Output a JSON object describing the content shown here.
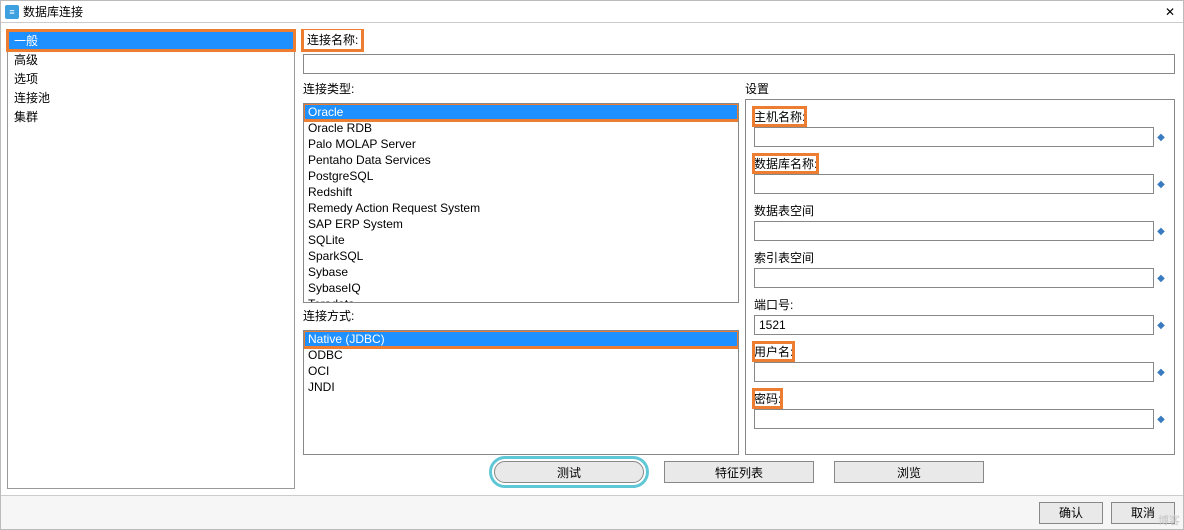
{
  "window": {
    "title": "数据库连接"
  },
  "sidebar": {
    "items": [
      {
        "label": "一般",
        "selected": true
      },
      {
        "label": "高级",
        "selected": false
      },
      {
        "label": "选项",
        "selected": false
      },
      {
        "label": "连接池",
        "selected": false
      },
      {
        "label": "集群",
        "selected": false
      }
    ]
  },
  "conn_name": {
    "label": "连接名称:",
    "value": ""
  },
  "conn_type": {
    "label": "连接类型:",
    "items": [
      {
        "label": "Oracle",
        "selected": true
      },
      {
        "label": "Oracle RDB"
      },
      {
        "label": "Palo MOLAP Server"
      },
      {
        "label": "Pentaho Data Services"
      },
      {
        "label": "PostgreSQL"
      },
      {
        "label": "Redshift"
      },
      {
        "label": "Remedy Action Request System"
      },
      {
        "label": "SAP ERP System"
      },
      {
        "label": "SQLite"
      },
      {
        "label": "SparkSQL"
      },
      {
        "label": "Sybase"
      },
      {
        "label": "SybaseIQ"
      },
      {
        "label": "Teradata"
      }
    ]
  },
  "conn_mode": {
    "label": "连接方式:",
    "items": [
      {
        "label": "Native (JDBC)",
        "selected": true
      },
      {
        "label": "ODBC"
      },
      {
        "label": "OCI"
      },
      {
        "label": "JNDI"
      }
    ]
  },
  "settings": {
    "title": "设置",
    "host_label": "主机名称:",
    "host": "",
    "db_label": "数据库名称:",
    "db": "",
    "ts_data_label": "数据表空间",
    "ts_data": "",
    "ts_index_label": "索引表空间",
    "ts_index": "",
    "port_label": "端口号:",
    "port": "1521",
    "user_label": "用户名:",
    "user": "",
    "pass_label": "密码:",
    "pass": ""
  },
  "buttons": {
    "test": "测试",
    "feature": "特征列表",
    "browse": "浏览",
    "ok": "确认",
    "cancel": "取消"
  },
  "watermark_hint": "博客"
}
